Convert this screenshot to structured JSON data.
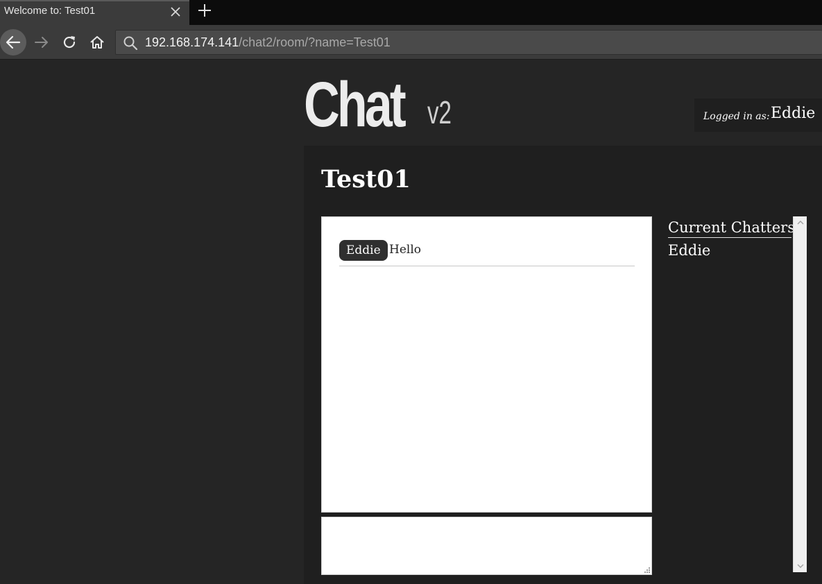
{
  "browser": {
    "tab_title": "Welcome to: Test01",
    "url_host": "192.168.174.141",
    "url_path": "/chat2/room/?name=Test01"
  },
  "logo": {
    "main": "Chat",
    "version": "v2"
  },
  "login": {
    "label": "Logged in as:",
    "username": "Eddie"
  },
  "room": {
    "title": "Test01",
    "messages": [
      {
        "user": "Eddie",
        "text": "Hello"
      }
    ],
    "input_value": ""
  },
  "chatters": {
    "title": "Current Chatters",
    "list": [
      "Eddie"
    ]
  }
}
